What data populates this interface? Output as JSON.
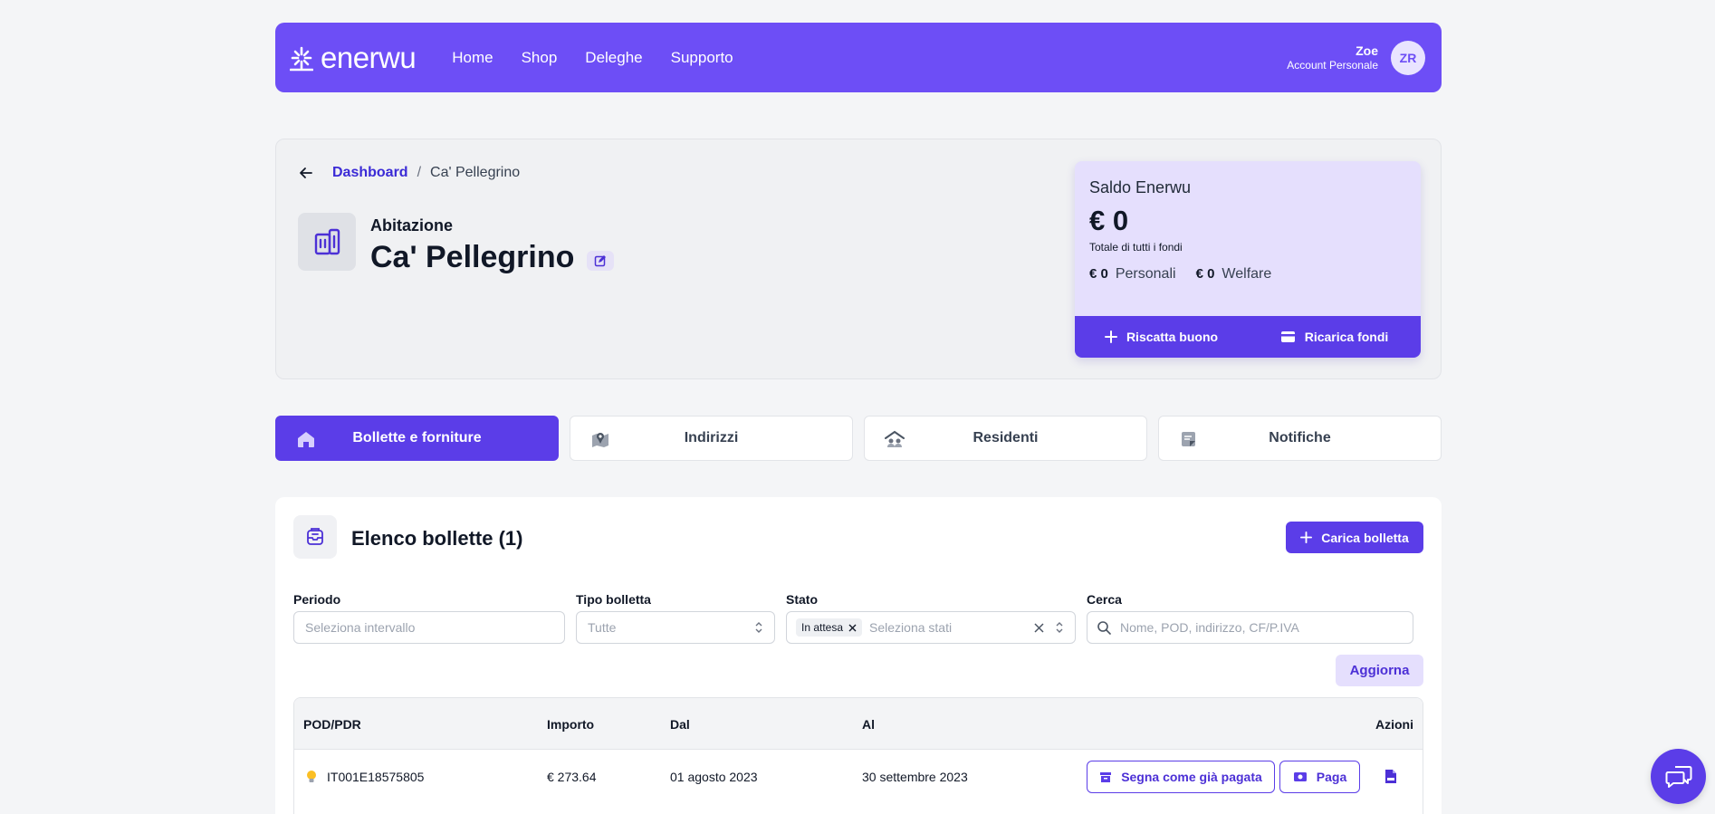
{
  "brand": {
    "name": "enerwu",
    "accent": "#6d4ef6",
    "primary": "#5b3de8"
  },
  "nav": {
    "links": [
      "Home",
      "Shop",
      "Deleghe",
      "Supporto"
    ]
  },
  "user": {
    "name": "Zoe",
    "account": "Account Personale",
    "initials": "ZR"
  },
  "breadcrumb": {
    "root": "Dashboard",
    "separator": "/",
    "current": "Ca' Pellegrino"
  },
  "home": {
    "type": "Abitazione",
    "name": "Ca' Pellegrino"
  },
  "balance": {
    "title": "Saldo Enerwu",
    "amount": "€ 0",
    "subtitle": "Totale di tutti i fondi",
    "personal_amount": "€ 0",
    "personal_label": "Personali",
    "welfare_amount": "€ 0",
    "welfare_label": "Welfare",
    "redeem_label": "Riscatta buono",
    "topup_label": "Ricarica fondi"
  },
  "tabs": [
    "Bollette e forniture",
    "Indirizzi",
    "Residenti",
    "Notifiche"
  ],
  "bills": {
    "title": "Elenco bollette (1)",
    "upload_label": "Carica bolletta",
    "filters": {
      "period_label": "Periodo",
      "period_placeholder": "Seleziona intervallo",
      "type_label": "Tipo bolletta",
      "type_value": "Tutte",
      "status_label": "Stato",
      "status_chip": "In attesa",
      "status_placeholder": "Seleziona stati",
      "search_label": "Cerca",
      "search_placeholder": "Nome, POD, indirizzo, CF/P.IVA"
    },
    "refresh_label": "Aggiorna",
    "columns": [
      "POD/PDR",
      "Importo",
      "Dal",
      "Al",
      "Azioni"
    ],
    "rows": [
      {
        "pod": "IT001E18575805",
        "amount": "€ 273.64",
        "from": "01 agosto 2023",
        "to": "30 settembre 2023",
        "mark_paid_label": "Segna come già pagata",
        "pay_label": "Paga"
      }
    ]
  }
}
